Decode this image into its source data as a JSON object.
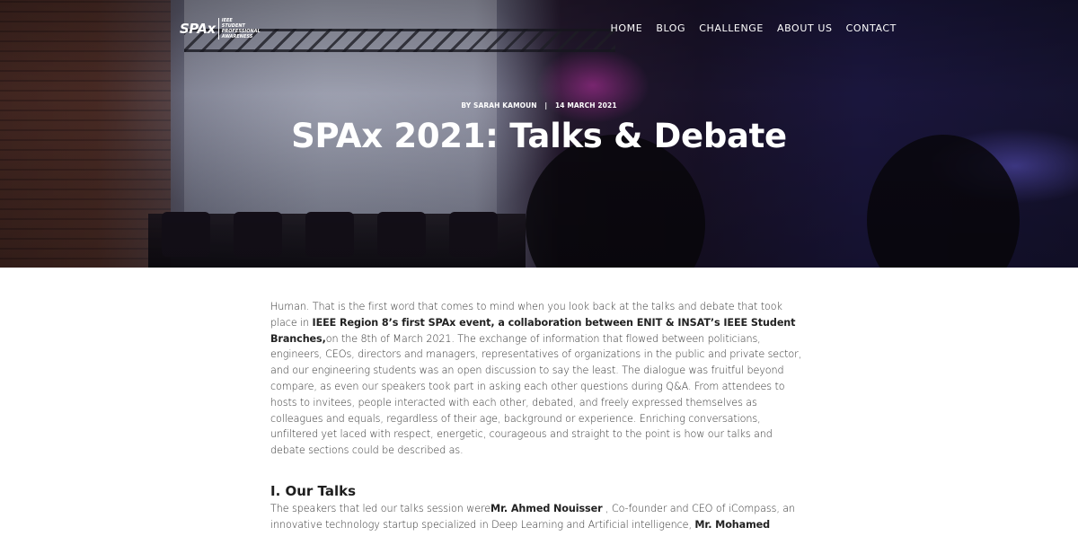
{
  "brand": {
    "logo_mark": "SPAx",
    "logo_sub_1": "IEEE",
    "logo_sub_2": "Student",
    "logo_sub_3": "Professional",
    "logo_sub_4": "Awareness"
  },
  "nav": {
    "items": [
      "HOME",
      "BLOG",
      "CHALLENGE",
      "ABOUT US",
      "CONTACT"
    ]
  },
  "post": {
    "author": "BY SARAH KAMOUN",
    "separator": "|",
    "date": "14 MARCH 2021",
    "title": "SPAx 2021: Talks & Debate"
  },
  "article": {
    "p1_a": "Human. That is the first word that comes to mind when you look back at the talks and debate that took place in ",
    "p1_bold": "IEEE Region 8’s first SPAx event, a collaboration between ENIT & INSAT’s IEEE Student Branches,",
    "p1_b": "on the 8th of March 2021. The exchange of information that flowed between politicians, engineers, CEOs, directors and managers, representatives of organizations in the public and private sector, and our engineering students was an open discussion to say the least. The dialogue was fruitful beyond compare, as even our speakers took part in asking each other questions during Q&A. From attendees to hosts to invitees, people interacted with each other, debated, and freely expressed themselves as colleagues and equals, regardless of their age, background or experience. Enriching conversations, unfiltered yet laced with respect, energetic, courageous and straight to the point is how our talks and debate sections could be described as.",
    "h_talks": "I. Our Talks",
    "p2_a": "The speakers that led our talks session were",
    "p2_bold1": "Mr. Ahmed Nouisser",
    "p2_b": " , Co-founder and CEO of iCompass, an innovative technology startup specialized in Deep Learning and Artificial intelligence, ",
    "p2_bold2": "Mr. Mohamed"
  },
  "colors": {
    "hero_text": "#ffffff",
    "body_text": "#333333",
    "heading": "#1e1e1e"
  }
}
